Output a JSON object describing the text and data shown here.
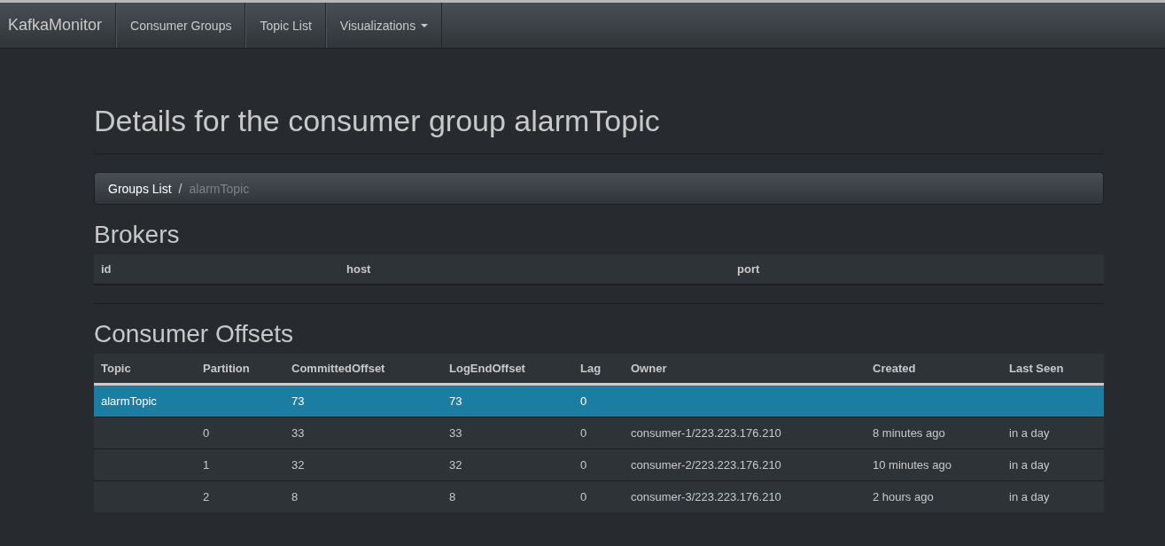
{
  "navbar": {
    "brand": "KafkaMonitor",
    "items": [
      {
        "label": "Consumer Groups",
        "dropdown": false
      },
      {
        "label": "Topic List",
        "dropdown": false
      },
      {
        "label": "Visualizations",
        "dropdown": true
      }
    ]
  },
  "page_title": "Details for the consumer group alarmTopic",
  "breadcrumb": {
    "separator": "/",
    "items": [
      {
        "label": "Groups List",
        "current": false
      },
      {
        "label": "alarmTopic",
        "current": true
      }
    ]
  },
  "brokers": {
    "heading": "Brokers",
    "columns": [
      "id",
      "host",
      "port"
    ]
  },
  "offsets": {
    "heading": "Consumer Offsets",
    "columns": [
      "Topic",
      "Partition",
      "CommittedOffset",
      "LogEndOffset",
      "Lag",
      "Owner",
      "Created",
      "Last Seen"
    ],
    "rows": [
      {
        "selected": true,
        "cells": [
          "alarmTopic",
          "",
          "73",
          "73",
          "0",
          "",
          "",
          ""
        ]
      },
      {
        "selected": false,
        "cells": [
          "",
          "0",
          "33",
          "33",
          "0",
          "consumer-1/223.223.176.210",
          "8 minutes ago",
          "in a day"
        ]
      },
      {
        "selected": false,
        "cells": [
          "",
          "1",
          "32",
          "32",
          "0",
          "consumer-2/223.223.176.210",
          "10 minutes ago",
          "in a day"
        ]
      },
      {
        "selected": false,
        "cells": [
          "",
          "2",
          "8",
          "8",
          "0",
          "consumer-3/223.223.176.210",
          "2 hours ago",
          "in a day"
        ]
      }
    ]
  }
}
